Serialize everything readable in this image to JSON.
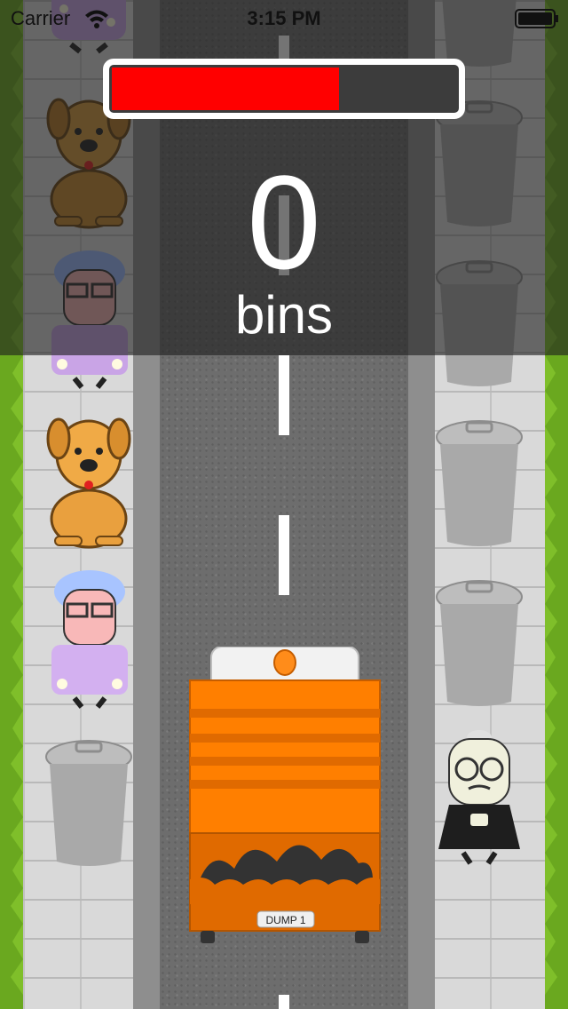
{
  "status_bar": {
    "carrier": "Carrier",
    "time": "3:15 PM",
    "icons": [
      "wifi-icon",
      "battery-icon"
    ]
  },
  "hud": {
    "fuel_level": 0.66,
    "fuel_color": "#ff0000",
    "score": "0",
    "score_label": "bins"
  },
  "truck": {
    "label": "DUMP 1",
    "color": "#ff7f00"
  },
  "scene": {
    "left_sidewalk": [
      "grandma",
      "dog",
      "grandma",
      "dog",
      "grandma",
      "trash-can"
    ],
    "right_sidewalk": [
      "trash-can",
      "trash-can",
      "trash-can",
      "trash-can",
      "trash-can",
      "old-man"
    ]
  },
  "colors": {
    "road": "#6d6d6d",
    "grass": "#7fbf2a",
    "hud_overlay": "rgba(30,30,30,0.62)"
  }
}
